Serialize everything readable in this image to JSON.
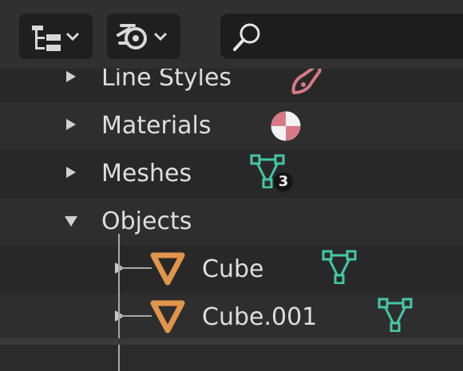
{
  "header": {
    "display_mode_icon": "outliner-tree-icon",
    "filter_icon": "blender-data-icon",
    "search_icon": "search-icon"
  },
  "rows": [
    {
      "label": "Line Styles",
      "expanded": false,
      "icon": "linestyle-brush-icon"
    },
    {
      "label": "Materials",
      "expanded": false,
      "icon": "material-ball-icon"
    },
    {
      "label": "Meshes",
      "expanded": false,
      "icon": "mesh-data-icon",
      "count": "3"
    },
    {
      "label": "Objects",
      "expanded": true
    },
    {
      "label": "Cube",
      "expanded": false,
      "icon": "object-icon",
      "data_icon": "mesh-data-icon"
    },
    {
      "label": "Cube.001",
      "expanded": false,
      "icon": "object-icon",
      "data_icon": "mesh-data-icon"
    }
  ],
  "colors": {
    "mesh_green": "#45c6a8",
    "object_orange": "#e0954a",
    "linestyle_pink": "#d87a86"
  }
}
